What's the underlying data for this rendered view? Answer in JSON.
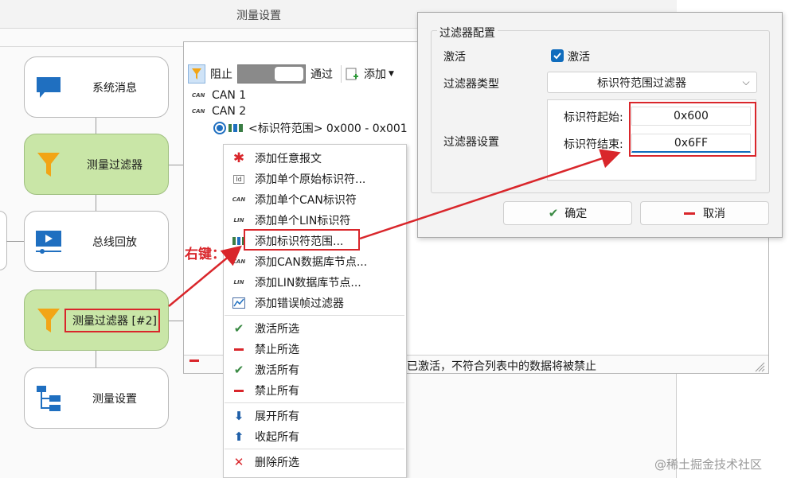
{
  "window": {
    "title": "测量设置"
  },
  "flow_blocks": [
    {
      "label": "系统消息",
      "icon": "chat-bubble-icon",
      "highlighted": false
    },
    {
      "label": "测量过滤器",
      "icon": "filter-funnel-icon",
      "highlighted": true
    },
    {
      "label": "总线回放",
      "icon": "video-play-icon",
      "highlighted": false
    },
    {
      "label": "测量过滤器 [#2]",
      "icon": "filter-funnel-icon",
      "highlighted": true
    },
    {
      "label": "测量设置",
      "icon": "tree-structure-icon",
      "highlighted": false
    }
  ],
  "toolbar": {
    "block_label": "阻止",
    "pass_label": "通过",
    "add_label": "添加"
  },
  "tree": {
    "items": [
      {
        "label": "CAN 1",
        "icon": "can-icon"
      },
      {
        "label": "CAN 2",
        "icon": "can-icon"
      },
      {
        "label": "<标识符范围> 0x000 - 0x001",
        "icon": "id-range-icon"
      }
    ],
    "can_icon_text": "CAN"
  },
  "status": {
    "text": "已激活，不符合列表中的数据将被禁止"
  },
  "context_menu": {
    "items": [
      {
        "label": "添加任意报文",
        "icon": "asterisk-icon"
      },
      {
        "label": "添加单个原始标识符...",
        "icon": "id-icon"
      },
      {
        "label": "添加单个CAN标识符",
        "icon": "can-icon"
      },
      {
        "label": "添加单个LIN标识符",
        "icon": "lin-icon"
      },
      {
        "label": "添加标识符范围...",
        "icon": "id-range-icon"
      },
      {
        "label": "添加CAN数据库节点...",
        "icon": "can-icon"
      },
      {
        "label": "添加LIN数据库节点...",
        "icon": "lin-icon"
      },
      {
        "label": "添加错误帧过滤器",
        "icon": "error-frame-icon"
      },
      {
        "label": "激活所选",
        "icon": "check-icon"
      },
      {
        "label": "禁止所选",
        "icon": "minus-icon"
      },
      {
        "label": "激活所有",
        "icon": "check-icon"
      },
      {
        "label": "禁止所有",
        "icon": "minus-icon"
      },
      {
        "label": "展开所有",
        "icon": "arrow-down-icon"
      },
      {
        "label": "收起所有",
        "icon": "arrow-up-icon"
      },
      {
        "label": "删除所选",
        "icon": "delete-x-icon"
      }
    ],
    "icon_texts": {
      "id": "Id",
      "can": "CAN",
      "lin": "LIN"
    }
  },
  "dialog": {
    "group_title": "过滤器配置",
    "activate_label": "激活",
    "activate_checkbox_label": "激活",
    "activate_checked": true,
    "filter_type_label": "过滤器类型",
    "filter_type_value": "标识符范围过滤器",
    "filter_settings_label": "过滤器设置",
    "id_start_label": "标识符起始:",
    "id_start_value": "0x600",
    "id_end_label": "标识符结束:",
    "id_end_value": "0x6FF",
    "ok_label": "确定",
    "cancel_label": "取消"
  },
  "annotation": {
    "right_click_label": "右键："
  },
  "watermark": "@稀土掘金技术社区",
  "colors": {
    "accent": "#0f6cbd",
    "highlight_green": "#c9e6a7",
    "annotation_red": "#d9262b",
    "funnel_orange": "#f2a516",
    "icon_blue": "#1f6fc0"
  }
}
